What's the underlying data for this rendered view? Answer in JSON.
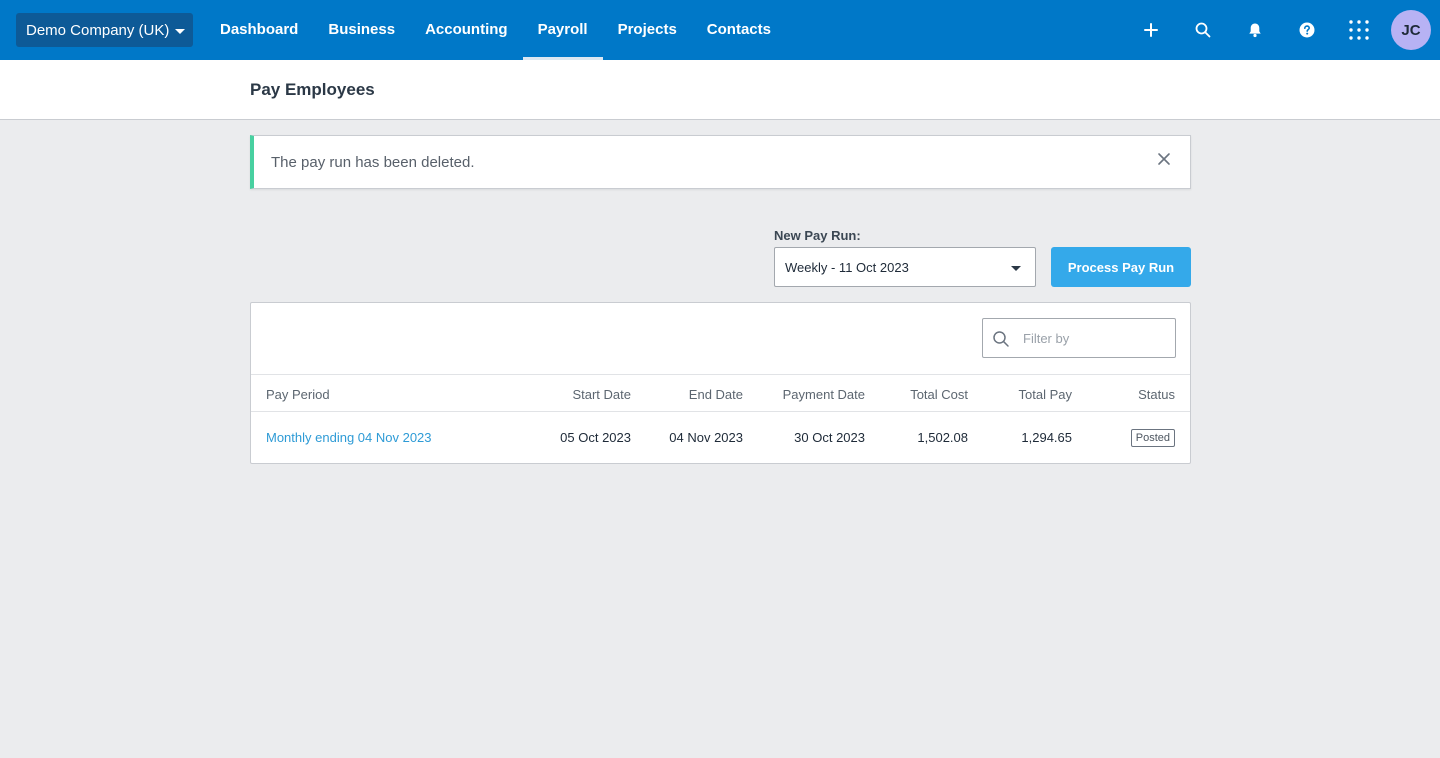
{
  "topnav": {
    "org_name": "Demo Company (UK)",
    "links": [
      {
        "label": "Dashboard",
        "active": false
      },
      {
        "label": "Business",
        "active": false
      },
      {
        "label": "Accounting",
        "active": false
      },
      {
        "label": "Payroll",
        "active": true
      },
      {
        "label": "Projects",
        "active": false
      },
      {
        "label": "Contacts",
        "active": false
      }
    ],
    "icons": [
      "plus-icon",
      "search-icon",
      "bell-icon",
      "help-icon",
      "apps-grid-icon"
    ],
    "avatar_initials": "JC",
    "colors": {
      "bar": "#0078c8",
      "org_button": "#0d5a97",
      "avatar": "#b7b2f4"
    }
  },
  "page": {
    "title": "Pay Employees"
  },
  "notification": {
    "message": "The pay run has been deleted.",
    "accent_color": "#48d0a0"
  },
  "new_pay_run": {
    "label": "New Pay Run:",
    "selected": "Weekly - 11 Oct 2023",
    "button_label": "Process Pay Run",
    "button_color": "#34a9ea"
  },
  "pay_runs": {
    "filter_placeholder": "Filter by",
    "columns": [
      "Pay Period",
      "Start Date",
      "End Date",
      "Payment Date",
      "Total Cost",
      "Total Pay",
      "Status"
    ],
    "rows": [
      {
        "pay_period": "Monthly ending 04 Nov 2023",
        "start_date": "05 Oct 2023",
        "end_date": "04 Nov 2023",
        "payment_date": "30 Oct 2023",
        "total_cost": "1,502.08",
        "total_pay": "1,294.65",
        "status": "Posted"
      }
    ]
  }
}
